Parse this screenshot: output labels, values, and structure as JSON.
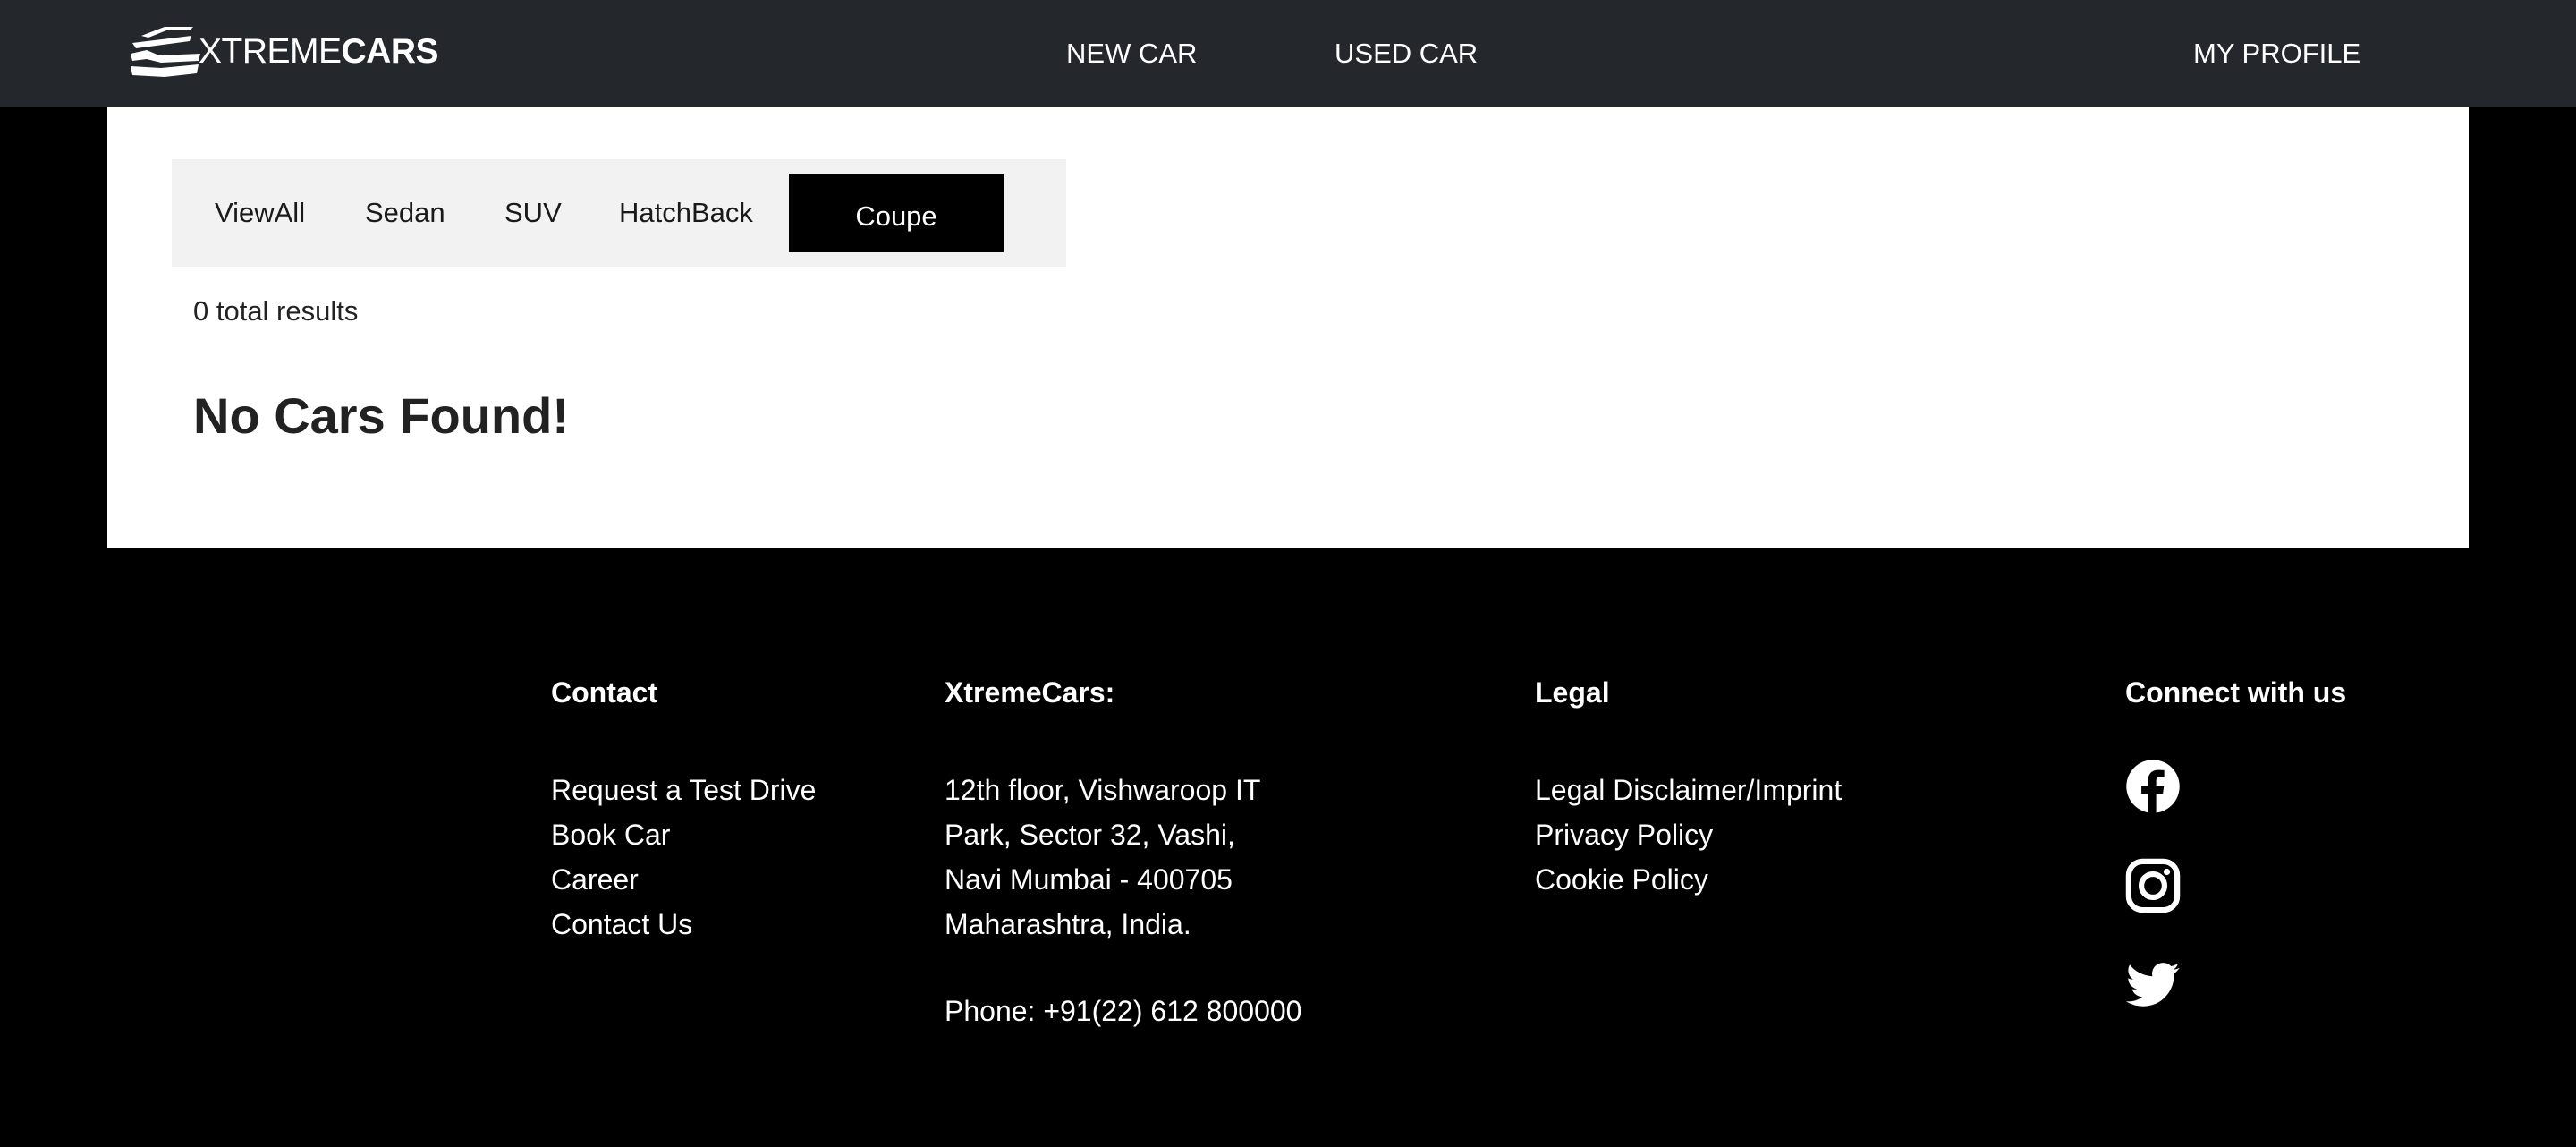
{
  "header": {
    "logo_light": "XTREME",
    "logo_bold": "CARS",
    "nav": {
      "new_car": "NEW CAR",
      "used_car": "USED CAR",
      "my_profile": "MY PROFILE"
    }
  },
  "filters": {
    "tabs": [
      "ViewAll",
      "Sedan",
      "SUV",
      "HatchBack",
      "Coupe"
    ],
    "selected": "Coupe"
  },
  "results": {
    "total": "0 total results",
    "empty_message": "No Cars Found!"
  },
  "footer": {
    "contact": {
      "heading": "Contact",
      "items": [
        "Request a Test Drive",
        "Book Car",
        "Career",
        "Contact Us"
      ]
    },
    "company": {
      "heading": "XtremeCars:",
      "address": [
        "12th floor, Vishwaroop IT",
        "Park, Sector 32, Vashi,",
        "Navi Mumbai - 400705",
        "Maharashtra, India."
      ],
      "phone": "Phone: +91(22) 612 800000"
    },
    "legal": {
      "heading": "Legal",
      "items": [
        "Legal Disclaimer/Imprint",
        "Privacy Policy",
        "Cookie Policy"
      ]
    },
    "connect": {
      "heading": "Connect with us",
      "icons": [
        "facebook-icon",
        "instagram-icon",
        "twitter-icon"
      ]
    }
  },
  "colors": {
    "header_bg": "#24272c",
    "page_bg": "#000000",
    "panel_bg": "#ffffff",
    "filter_bar_bg": "#f2f2f2",
    "active_tab_bg": "#000000"
  }
}
